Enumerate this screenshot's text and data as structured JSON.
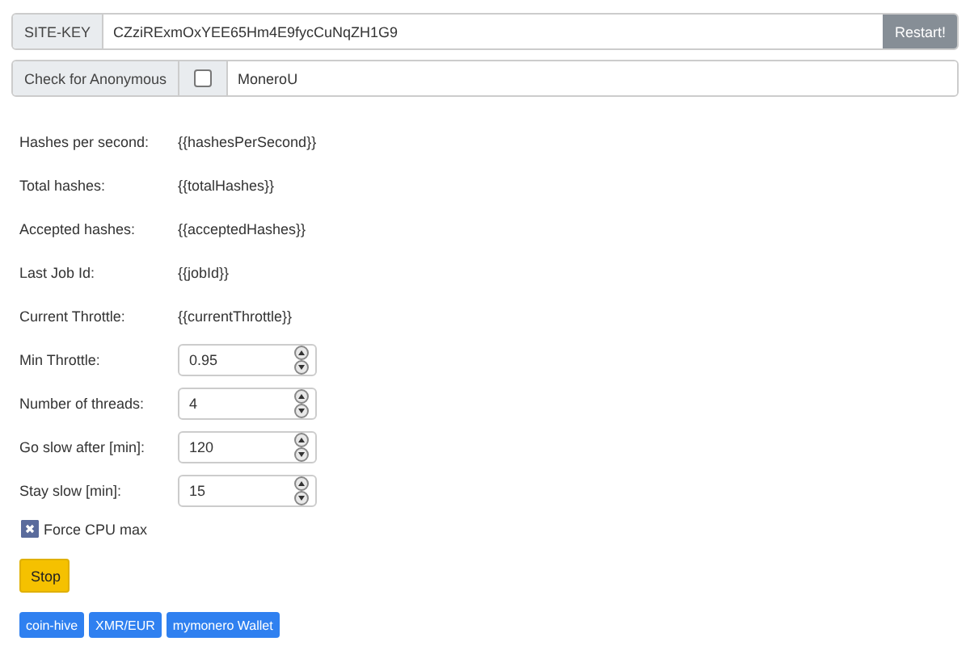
{
  "site_key": {
    "label": "SITE-KEY",
    "value": "CZziRExmOxYEE65Hm4E9fycCuNqZH1G9",
    "button": "Restart!"
  },
  "anonymous": {
    "label": "Check for Anonymous",
    "checked": false,
    "value": "MoneroU"
  },
  "stats": [
    {
      "label": "Hashes per second:",
      "value": "{{hashesPerSecond}}"
    },
    {
      "label": "Total hashes:",
      "value": "{{totalHashes}}"
    },
    {
      "label": "Accepted hashes:",
      "value": "{{acceptedHashes}}"
    },
    {
      "label": "Last Job Id:",
      "value": "{{jobId}}"
    },
    {
      "label": "Current Throttle:",
      "value": "{{currentThrottle}}"
    }
  ],
  "settings": [
    {
      "label": "Min Throttle:",
      "value": "0.95"
    },
    {
      "label": "Number of threads:",
      "value": "4"
    },
    {
      "label": "Go slow after [min]:",
      "value": "120"
    },
    {
      "label": "Stay slow [min]:",
      "value": "15"
    }
  ],
  "force_cpu": {
    "label": "Force CPU max",
    "checked": true
  },
  "stop_button": "Stop",
  "links": [
    "coin-hive",
    "XMR/EUR",
    "mymonero Wallet"
  ]
}
